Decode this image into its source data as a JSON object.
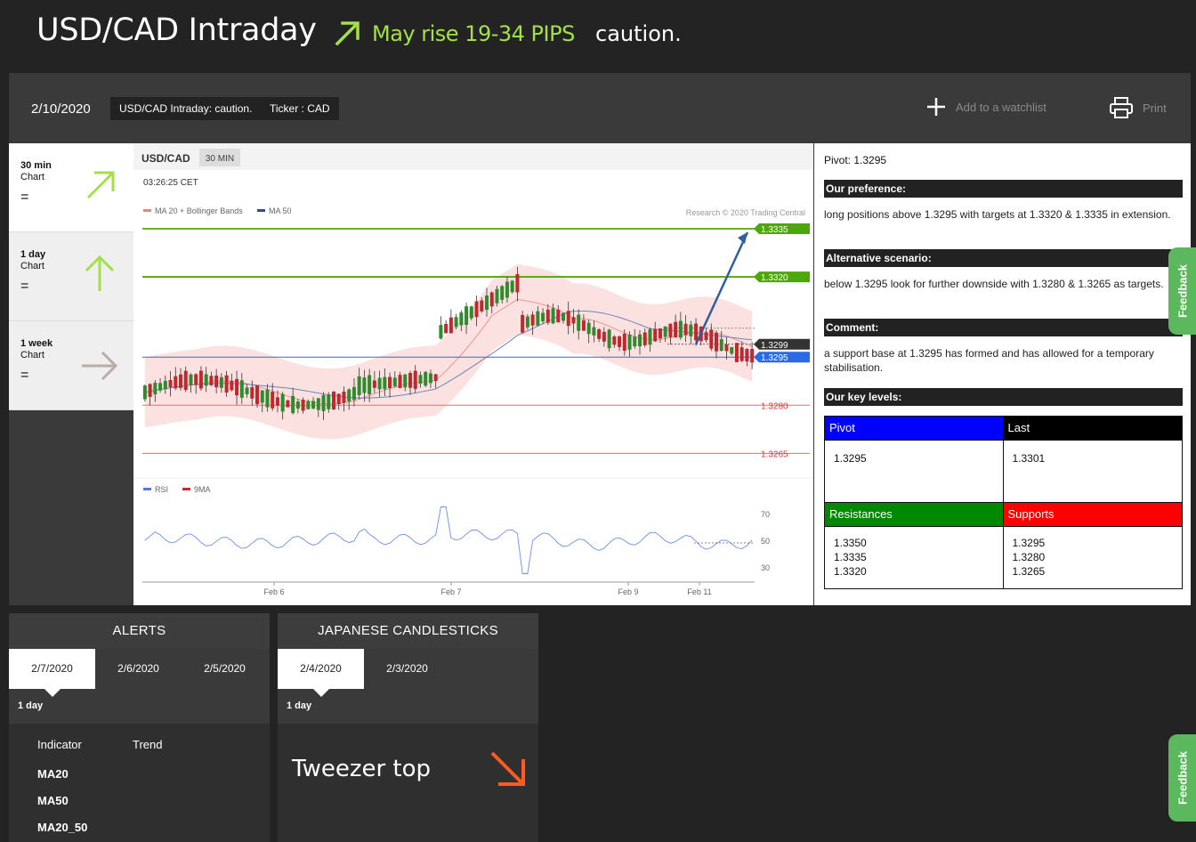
{
  "header": {
    "title": "USD/CAD Intraday",
    "forecast": "May rise 19-34 PIPS",
    "status": "caution.",
    "arrow_color": "#a3e048"
  },
  "toolbar": {
    "date": "2/10/2020",
    "tag_title": "USD/CAD Intraday: caution.",
    "tag_ticker": "Ticker : CAD",
    "watchlist_label": "Add to a watchlist",
    "print_label": "Print"
  },
  "timeframes": [
    {
      "period": "30 min",
      "label": "Chart",
      "value": "=",
      "icon": "arrow-up-right-icon",
      "color": "#a3e048"
    },
    {
      "period": "1 day",
      "label": "Chart",
      "value": "=",
      "icon": "arrow-up-icon",
      "color": "#a3e048"
    },
    {
      "period": "1 week",
      "label": "Chart",
      "value": "=",
      "icon": "arrow-right-icon",
      "color": "#b8aea6"
    }
  ],
  "chart_data": {
    "type": "candlestick",
    "symbol": "USD/CAD",
    "interval": "30 MIN",
    "time": "03:26:25 CET",
    "credit": "Research © 2020 Trading Central",
    "legend": [
      {
        "name": "MA 20 + Bollinger Bands",
        "color": "#f08080"
      },
      {
        "name": "MA 50",
        "color": "#2c4f8a"
      }
    ],
    "x_labels": [
      "Feb 6",
      "Feb 7",
      "Feb 9",
      "Feb 11"
    ],
    "ylim": [
      1.3255,
      1.3345
    ],
    "levels": [
      {
        "value": 1.3335,
        "label": "1.3335",
        "kind": "resistance",
        "color": "#4ea60c"
      },
      {
        "value": 1.332,
        "label": "1.3320",
        "kind": "resistance",
        "color": "#4ea60c"
      },
      {
        "value": 1.3299,
        "label": "1.3299",
        "kind": "last",
        "color": "#333333"
      },
      {
        "value": 1.3295,
        "label": "1.3295",
        "kind": "pivot",
        "color": "#2a6ae8"
      },
      {
        "value": 1.328,
        "label": "1.3280",
        "kind": "support",
        "color": "#e86d6d"
      },
      {
        "value": 1.3265,
        "label": "1.3265",
        "kind": "support",
        "color": "#e86d6d"
      }
    ],
    "rsi": {
      "legend": [
        {
          "name": "RSI",
          "color": "#5577dd"
        },
        {
          "name": "9MA",
          "color": "#dd2222"
        }
      ],
      "ticks": [
        "70",
        "50",
        "30"
      ],
      "ylim": [
        20,
        80
      ]
    }
  },
  "analysis": {
    "pivot": "Pivot: 1.3295",
    "preference_title": "Our preference:",
    "preference": "long positions above 1.3295 with targets at 1.3320 & 1.3335 in extension.",
    "alternative_title": "Alternative scenario:",
    "alternative": "below 1.3295 look for further downside with 1.3280 & 1.3265 as targets.",
    "comment_title": "Comment:",
    "comment": "a support base at 1.3295 has formed and has allowed for a temporary stabilisation.",
    "levels_title": "Our key levels:",
    "pivot_head": "Pivot",
    "pivot_value": "1.3295",
    "last_head": "Last",
    "last_value": "1.3301",
    "resistances_head": "Resistances",
    "resistances": [
      "1.3350",
      "1.3335",
      "1.3320"
    ],
    "supports_head": "Supports",
    "supports": [
      "1.3295",
      "1.3280",
      "1.3265"
    ],
    "colors": {
      "pivot": "#0000ff",
      "last": "#000000",
      "resistances": "#008800",
      "supports": "#ff0000"
    }
  },
  "feedback_label": "Feedback",
  "alerts": {
    "title": "ALERTS",
    "tabs": [
      "2/7/2020",
      "2/6/2020",
      "2/5/2020"
    ],
    "sub": "1 day",
    "col_indicator": "Indicator",
    "col_trend": "Trend",
    "rows": [
      "MA20",
      "MA50",
      "MA20_50"
    ]
  },
  "candlesticks": {
    "title": "JAPANESE CANDLESTICKS",
    "tabs": [
      "2/4/2020",
      "2/3/2020"
    ],
    "sub": "1 day",
    "pattern": "Tweezer top",
    "arrow_color": "#ff5a1f"
  }
}
